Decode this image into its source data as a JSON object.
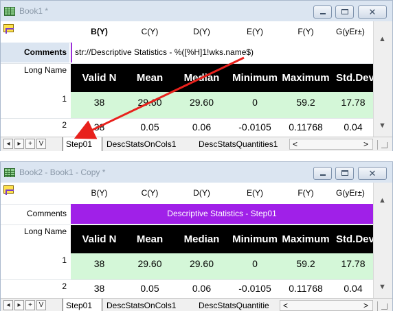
{
  "window1": {
    "title": "Book1 *",
    "col_headers": {
      "b": "B(Y)",
      "c": "C(Y)",
      "d": "D(Y)",
      "e": "E(Y)",
      "f": "F(Y)",
      "g": "G(yEr±)"
    },
    "labels": {
      "comments": "Comments",
      "long_name": "Long Name"
    },
    "comment_text": "str://Descriptive Statistics - %([%H]1!wks.name$)",
    "long_names": {
      "b": "Valid N",
      "c": "Mean",
      "d": "Median",
      "e": "Minimum",
      "f": "Maximum",
      "g": "Std.Dev"
    },
    "rows": [
      {
        "num": "1",
        "b": "38",
        "c": "29.60",
        "d": "29.60",
        "e": "0",
        "f": "59.2",
        "g": "17.78"
      },
      {
        "num": "2",
        "b": "38",
        "c": "0.05",
        "d": "0.06",
        "e": "-0.0105",
        "f": "0.11768",
        "g": "0.04"
      }
    ],
    "tabs": [
      "Step01",
      "DescStatsOnCols1",
      "DescStatsQuantities1"
    ]
  },
  "window2": {
    "title": "Book2 - Book1 - Copy *",
    "col_headers": {
      "b": "B(Y)",
      "c": "C(Y)",
      "d": "D(Y)",
      "e": "E(Y)",
      "f": "F(Y)",
      "g": "G(yEr±)"
    },
    "labels": {
      "comments": "Comments",
      "long_name": "Long Name"
    },
    "comment_text": "Descriptive Statistics - Step01",
    "long_names": {
      "b": "Valid N",
      "c": "Mean",
      "d": "Median",
      "e": "Minimum",
      "f": "Maximum",
      "g": "Std.Dev"
    },
    "rows": [
      {
        "num": "1",
        "b": "38",
        "c": "29.60",
        "d": "29.60",
        "e": "0",
        "f": "59.2",
        "g": "17.78"
      },
      {
        "num": "2",
        "b": "38",
        "c": "0.05",
        "d": "0.06",
        "e": "-0.0105",
        "f": "0.11768",
        "g": "0.04"
      }
    ],
    "tabs": [
      "Step01",
      "DescStatsOnCols1",
      "DescStatsQuantitie"
    ]
  },
  "nav_buttons": {
    "prev": "◂",
    "next": "▸",
    "add": "+",
    "more": "V"
  },
  "window_controls": {
    "close": "✕"
  },
  "scroll_glyphs": {
    "up": "▲",
    "down": "▼",
    "left": "<",
    "right": ">"
  },
  "accent_colors": {
    "comment_bg": "#a020e8",
    "long_name_bg": "#000000",
    "data_row_bg": "#d4f7d8",
    "arrow": "#e8211c"
  }
}
